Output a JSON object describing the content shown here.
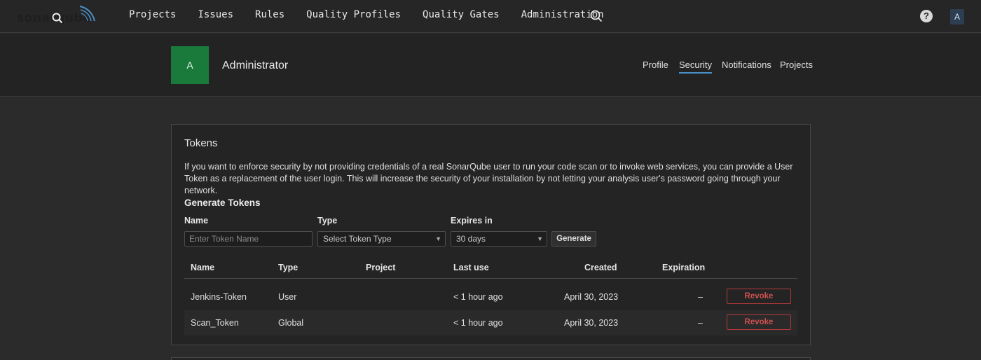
{
  "nav": {
    "logo_text": "sonarqube",
    "items": [
      "Projects",
      "Issues",
      "Rules",
      "Quality Profiles",
      "Quality Gates",
      "Administration"
    ],
    "avatar_letter": "A",
    "help_glyph": "?"
  },
  "account": {
    "avatar_letter": "A",
    "name": "Administrator",
    "tabs": [
      "Profile",
      "Security",
      "Notifications",
      "Projects"
    ],
    "active_tab": "Security"
  },
  "tokens": {
    "title": "Tokens",
    "description": "If you want to enforce security by not providing credentials of a real SonarQube user to run your code scan or to invoke web services, you can provide a User Token as a replacement of the user login. This will increase the security of your installation by not letting your analysis user's password going through your network.",
    "generate_title": "Generate Tokens",
    "labels": {
      "name": "Name",
      "type": "Type",
      "expires": "Expires in"
    },
    "name_placeholder": "Enter Token Name",
    "type_value": "Select Token Type",
    "expires_value": "30 days",
    "generate_label": "Generate",
    "columns": [
      "Name",
      "Type",
      "Project",
      "Last use",
      "Created",
      "Expiration"
    ],
    "rows": [
      {
        "name": "Jenkins-Token",
        "type": "User",
        "project": "",
        "last_use": "< 1 hour ago",
        "created": "April 30, 2023",
        "expiration": "–",
        "action": "Revoke"
      },
      {
        "name": "Scan_Token",
        "type": "Global",
        "project": "",
        "last_use": "< 1 hour ago",
        "created": "April 30, 2023",
        "expiration": "–",
        "action": "Revoke"
      }
    ]
  },
  "colors": {
    "accent": "#4a90c8",
    "avatar_green": "#1a7a3c",
    "danger": "#d05050"
  }
}
